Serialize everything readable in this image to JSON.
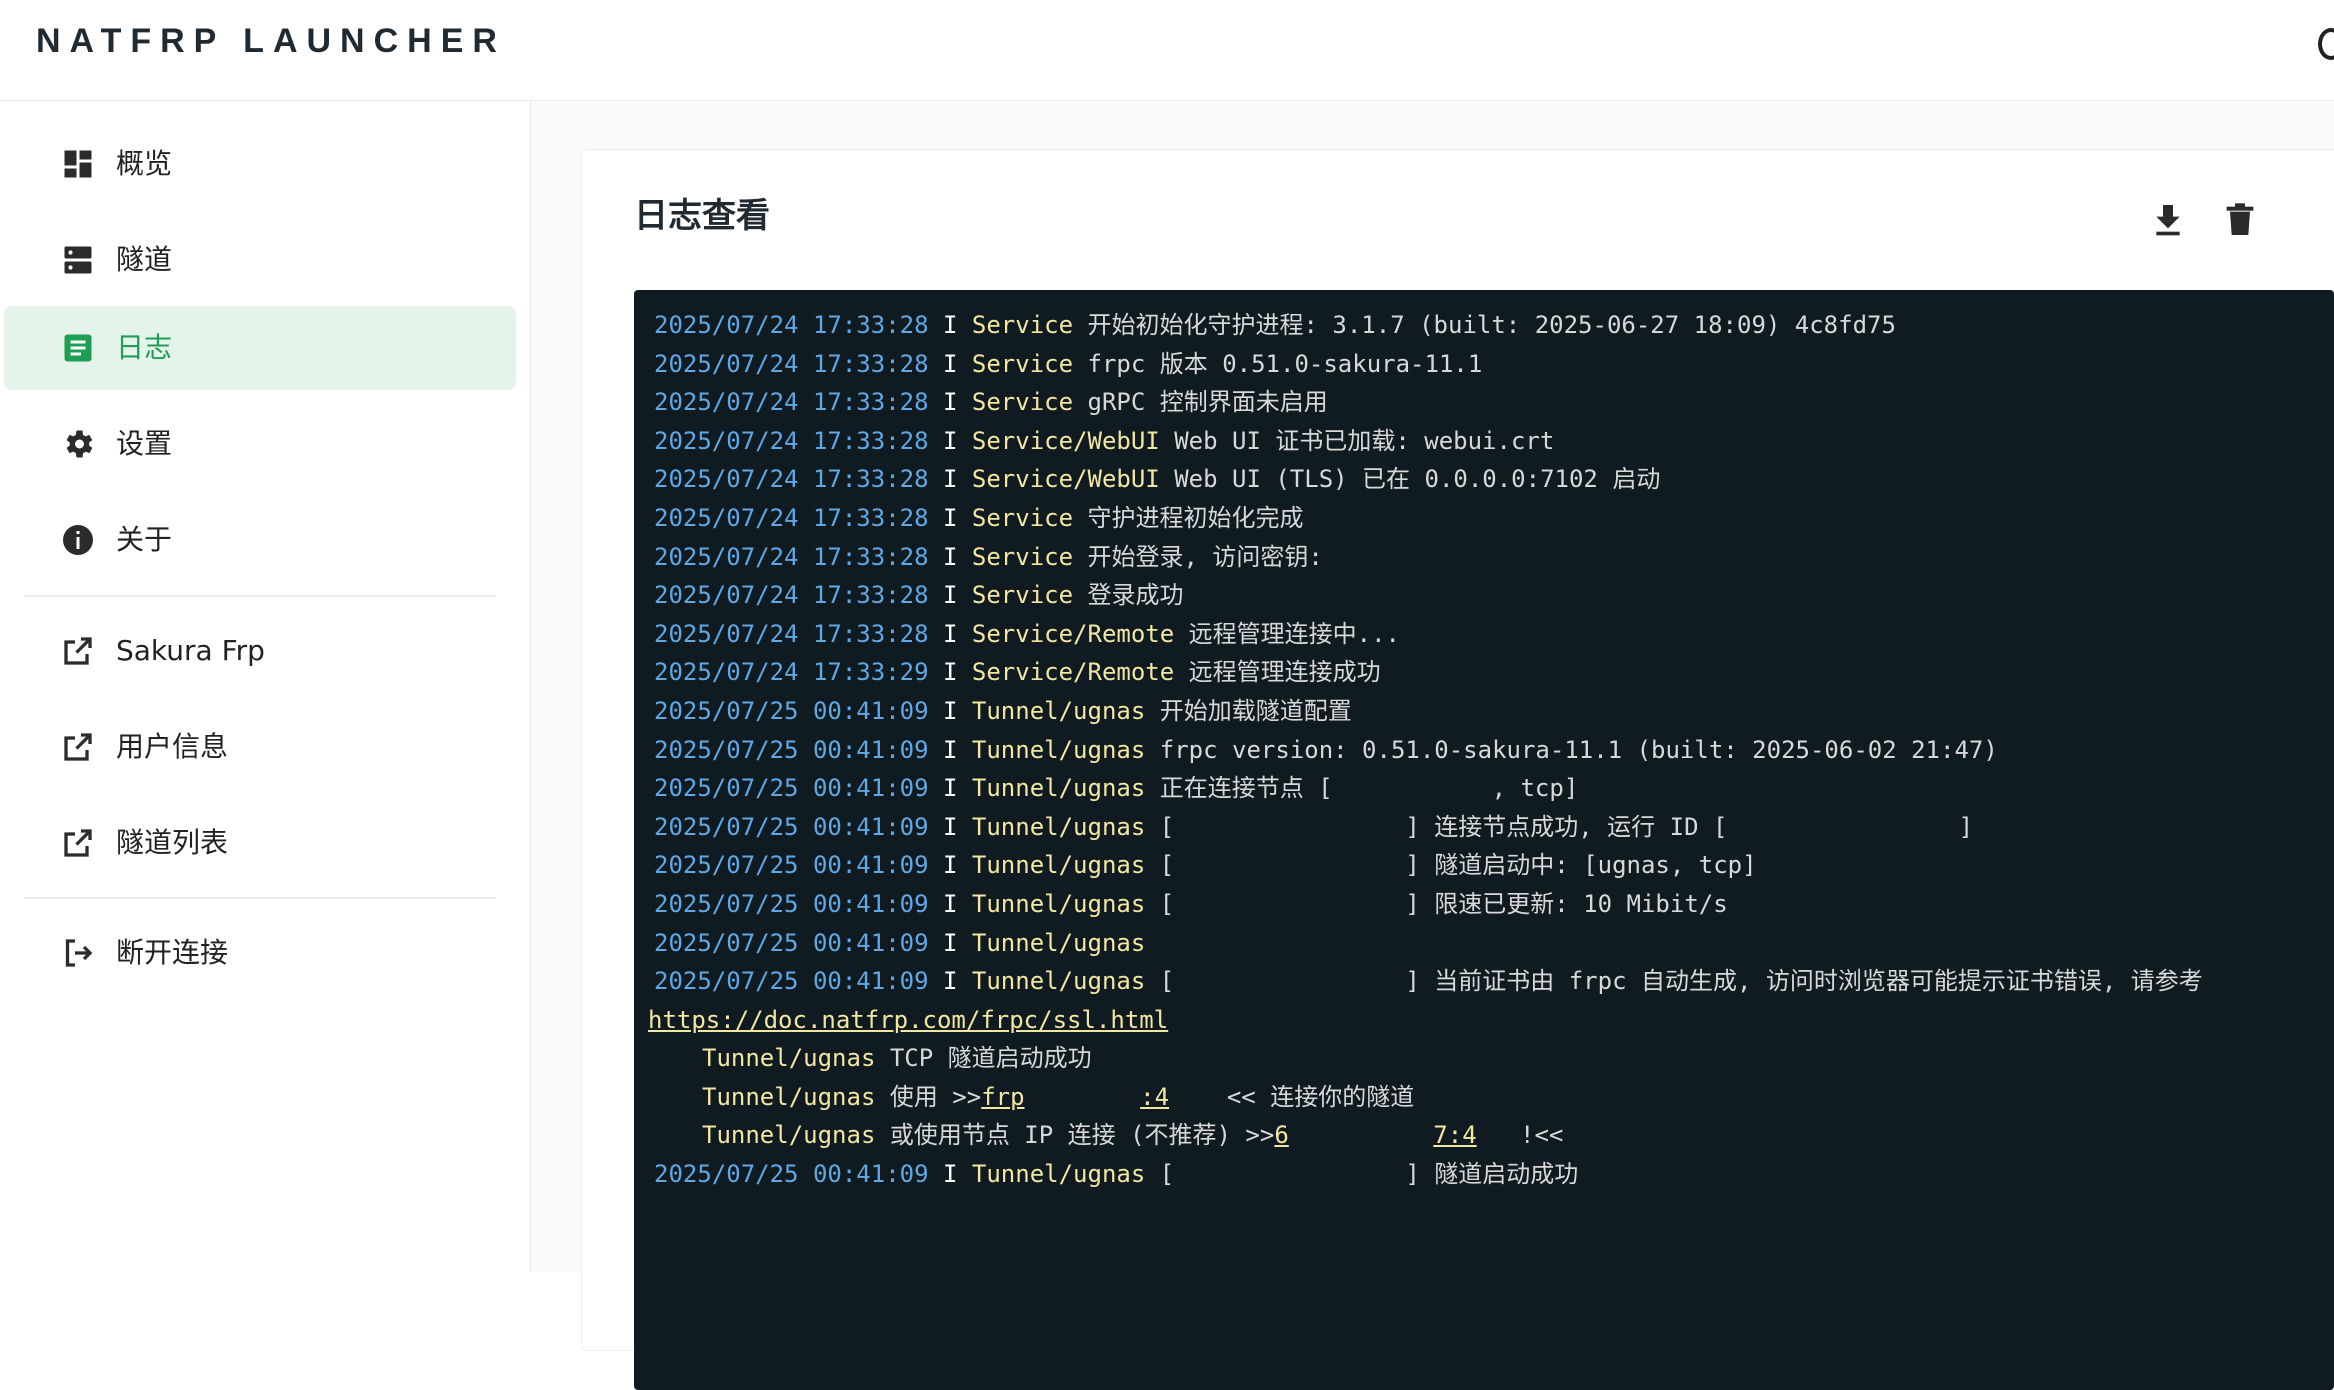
{
  "app": {
    "brand": "NATFRP LAUNCHER"
  },
  "sidebar": {
    "items": [
      {
        "label": "概览",
        "icon": "dashboard-icon"
      },
      {
        "label": "隧道",
        "icon": "server-icon"
      },
      {
        "label": "日志",
        "icon": "log-document-icon",
        "active": true
      },
      {
        "label": "设置",
        "icon": "gear-icon"
      },
      {
        "label": "关于",
        "icon": "info-icon"
      }
    ],
    "links": [
      {
        "label": "Sakura Frp",
        "icon": "external-link-icon"
      },
      {
        "label": "用户信息",
        "icon": "external-link-icon"
      },
      {
        "label": "隧道列表",
        "icon": "external-link-icon"
      }
    ],
    "logout": {
      "label": "断开连接",
      "icon": "logout-icon"
    }
  },
  "main": {
    "title": "日志查看",
    "actions": [
      {
        "name": "download",
        "icon": "download-icon"
      },
      {
        "name": "clear",
        "icon": "trash-icon"
      }
    ]
  },
  "log": [
    {
      "ts": "2025/07/24 17:33:28",
      "lvl": "I",
      "src": "Service",
      "msg": "开始初始化守护进程: 3.1.7 (built: 2025-06-27 18:09) 4c8fd75"
    },
    {
      "ts": "2025/07/24 17:33:28",
      "lvl": "I",
      "src": "Service",
      "msg": "frpc 版本 0.51.0-sakura-11.1"
    },
    {
      "ts": "2025/07/24 17:33:28",
      "lvl": "I",
      "src": "Service",
      "msg": "gRPC 控制界面未启用"
    },
    {
      "ts": "2025/07/24 17:33:28",
      "lvl": "I",
      "src": "Service/WebUI",
      "msg": "Web UI 证书已加载: webui.crt"
    },
    {
      "ts": "2025/07/24 17:33:28",
      "lvl": "I",
      "src": "Service/WebUI",
      "msg": "Web UI (TLS) 已在 0.0.0.0:7102 启动"
    },
    {
      "ts": "2025/07/24 17:33:28",
      "lvl": "I",
      "src": "Service",
      "msg": "守护进程初始化完成"
    },
    {
      "ts": "2025/07/24 17:33:28",
      "lvl": "I",
      "src": "Service",
      "msg": "开始登录, 访问密钥:"
    },
    {
      "ts": "2025/07/24 17:33:28",
      "lvl": "I",
      "src": "Service",
      "msg": "登录成功"
    },
    {
      "ts": "2025/07/24 17:33:28",
      "lvl": "I",
      "src": "Service/Remote",
      "msg": "远程管理连接中..."
    },
    {
      "ts": "2025/07/24 17:33:29",
      "lvl": "I",
      "src": "Service/Remote",
      "msg": "远程管理连接成功"
    },
    {
      "ts": "2025/07/25 00:41:09",
      "lvl": "I",
      "src": "Tunnel/ugnas",
      "msg": "开始加载隧道配置"
    },
    {
      "ts": "2025/07/25 00:41:09",
      "lvl": "I",
      "src": "Tunnel/ugnas",
      "msg": "frpc version: 0.51.0-sakura-11.1 (built: 2025-06-02 21:47)"
    },
    {
      "ts": "2025/07/25 00:41:09",
      "lvl": "I",
      "src": "Tunnel/ugnas",
      "msg": "正在连接节点 [           , tcp]"
    },
    {
      "ts": "2025/07/25 00:41:09",
      "lvl": "I",
      "src": "Tunnel/ugnas",
      "msg": "[                ] 连接节点成功, 运行 ID [                ]"
    },
    {
      "ts": "2025/07/25 00:41:09",
      "lvl": "I",
      "src": "Tunnel/ugnas",
      "msg": "[                ] 隧道启动中: [ugnas, tcp]"
    },
    {
      "ts": "2025/07/25 00:41:09",
      "lvl": "I",
      "src": "Tunnel/ugnas",
      "msg": "[                ] 限速已更新: 10 Mibit/s"
    },
    {
      "ts": "2025/07/25 00:41:09",
      "lvl": "I",
      "src": "Tunnel/ugnas",
      "msg": ""
    },
    {
      "ts": "2025/07/25 00:41:09",
      "lvl": "I",
      "src": "Tunnel/ugnas",
      "msg": "[                ] 当前证书由 frpc 自动生成, 访问时浏览器可能提示证书错误, 请参考"
    }
  ],
  "log_extra": {
    "url": "https://doc.natfrp.com/frpc/ssl.html",
    "line1_src": "Tunnel/ugnas",
    "line1_msg": "TCP 隧道启动成功",
    "line2_src": "Tunnel/ugnas",
    "line2_pre": "使用 >>",
    "line2_a": "frp",
    "line2_b": ":4",
    "line2_post": "<< 连接你的隧道",
    "line3_src": "Tunnel/ugnas",
    "line3_pre": "或使用节点 IP 连接 (不推荐) >>",
    "line3_a": "6",
    "line3_b": "7:4",
    "line3_post": "!<<",
    "last_ts": "2025/07/25 00:41:09",
    "last_lvl": "I",
    "last_src": "Tunnel/ugnas",
    "last_msg": "[                ] 隧道启动成功"
  },
  "colors": {
    "accent": "#1e9e55",
    "active_bg": "#e5f4ea",
    "terminal_bg": "#0f1b20",
    "timestamp": "#5fa8e6",
    "source": "#f2e6a0"
  }
}
